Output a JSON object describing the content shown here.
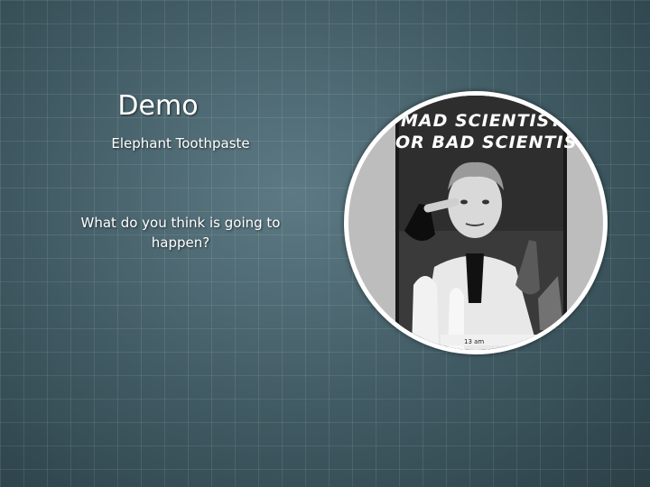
{
  "slide": {
    "title": "Demo",
    "subtitle": "Elephant Toothpaste",
    "question": "What do you think is going to happen?"
  },
  "photo": {
    "caption_line1": "MAD SCIENTIST...",
    "caption_line2": "OR BAD SCIENTIST?",
    "footnote": "13 am"
  },
  "colors": {
    "background": "#3f5962",
    "frame": "#ffffff",
    "text": "#ffffff"
  }
}
